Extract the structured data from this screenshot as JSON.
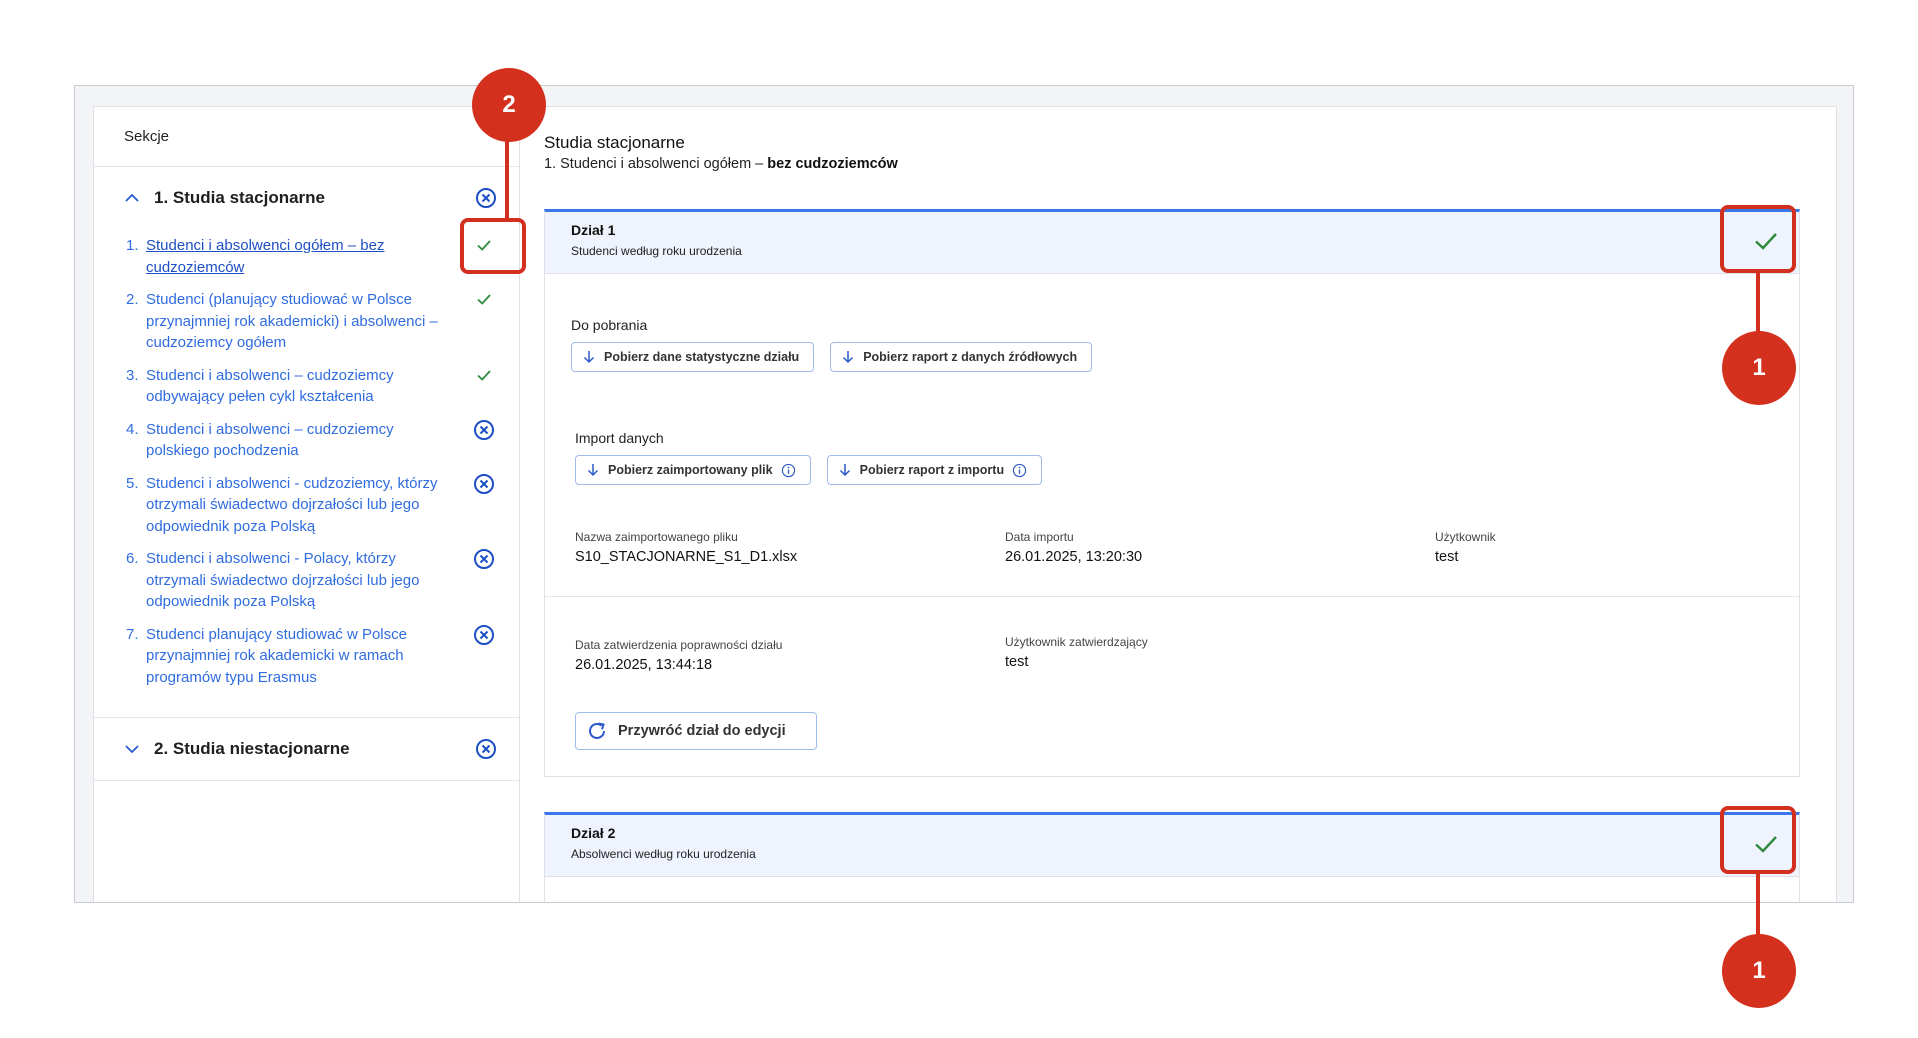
{
  "sidebar": {
    "header": "Sekcje",
    "sections": [
      {
        "label": "1. Studia stacjonarne",
        "expanded": true,
        "status": "error",
        "items": [
          {
            "num": "1.",
            "label": "Studenci i absolwenci ogółem – bez cudzoziemców",
            "status": "ok",
            "active": true
          },
          {
            "num": "2.",
            "label": "Studenci (planujący studiować w Polsce przynajmniej rok akademicki) i absolwenci – cudzoziemcy ogółem",
            "status": "ok"
          },
          {
            "num": "3.",
            "label": "Studenci i absolwenci – cudzoziemcy odbywający pełen cykl kształcenia",
            "status": "ok"
          },
          {
            "num": "4.",
            "label": "Studenci i absolwenci – cudzoziemcy polskiego pochodzenia",
            "status": "error"
          },
          {
            "num": "5.",
            "label": "Studenci i absolwenci - cudzoziemcy, którzy otrzymali świadectwo dojrzałości lub jego odpowiednik poza Polską",
            "status": "error"
          },
          {
            "num": "6.",
            "label": "Studenci i absolwenci - Polacy, którzy otrzymali świadectwo dojrzałości lub jego odpowiednik poza Polską",
            "status": "error"
          },
          {
            "num": "7.",
            "label": "Studenci planujący studiować w Polsce przynajmniej rok akademicki w ramach programów typu Erasmus",
            "status": "error"
          }
        ]
      },
      {
        "label": "2. Studia niestacjonarne",
        "expanded": false,
        "status": "error"
      }
    ]
  },
  "main": {
    "title": "Studia stacjonarne",
    "subtitle_prefix": "1. Studenci i absolwenci ogółem –",
    "subtitle_bold": "bez cudzoziemców",
    "dzial1": {
      "title": "Dział 1",
      "subtitle": "Studenci według roku urodzenia",
      "downloads_label": "Do pobrania",
      "btn_stats": "Pobierz dane statystyczne działu",
      "btn_report_source": "Pobierz raport z danych źródłowych",
      "import_label": "Import danych",
      "btn_imported_file": "Pobierz zaimportowany plik",
      "btn_import_report": "Pobierz raport z importu",
      "file_name_label": "Nazwa zaimportowanego pliku",
      "file_name_value": "S10_STACJONARNE_S1_D1.xlsx",
      "import_date_label": "Data importu",
      "import_date_value": "26.01.2025, 13:20:30",
      "user_label": "Użytkownik",
      "user_value": "test",
      "approval_date_label": "Data zatwierdzenia poprawności działu",
      "approval_date_value": "26.01.2025, 13:44:18",
      "approver_label": "Użytkownik zatwierdzający",
      "approver_value": "test",
      "btn_restore": "Przywróć dział do edycji"
    },
    "dzial2": {
      "title": "Dział 2",
      "subtitle": "Absolwenci według roku urodzenia"
    }
  },
  "annotations": {
    "callout_1": "1",
    "callout_2": "2",
    "color": "#d3301e"
  },
  "colors": {
    "accent": "#3b78e7",
    "link": "#2f6ce0",
    "ok": "#2e8a3d",
    "header_bg": "#eef3fd"
  }
}
